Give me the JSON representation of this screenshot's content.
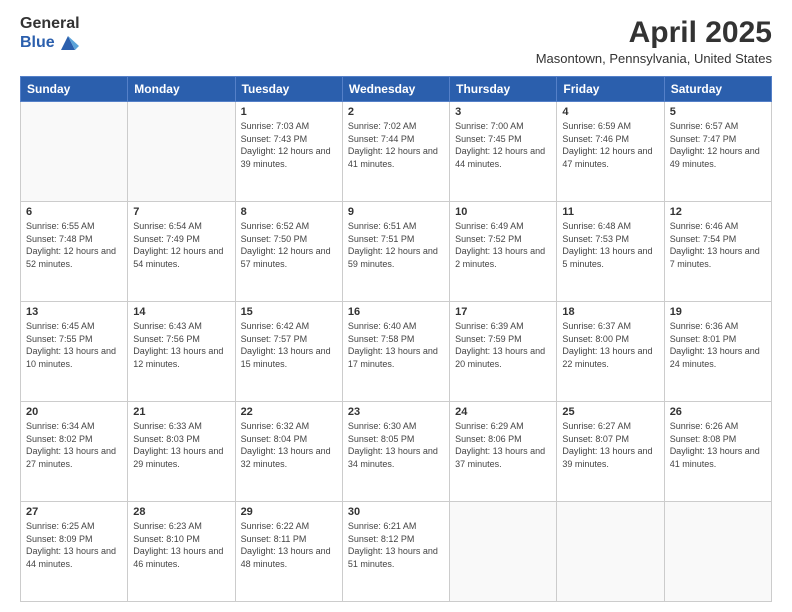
{
  "header": {
    "logo_general": "General",
    "logo_blue": "Blue",
    "title": "April 2025",
    "subtitle": "Masontown, Pennsylvania, United States"
  },
  "calendar": {
    "days_of_week": [
      "Sunday",
      "Monday",
      "Tuesday",
      "Wednesday",
      "Thursday",
      "Friday",
      "Saturday"
    ],
    "weeks": [
      [
        {
          "day": "",
          "info": ""
        },
        {
          "day": "",
          "info": ""
        },
        {
          "day": "1",
          "info": "Sunrise: 7:03 AM\nSunset: 7:43 PM\nDaylight: 12 hours and 39 minutes."
        },
        {
          "day": "2",
          "info": "Sunrise: 7:02 AM\nSunset: 7:44 PM\nDaylight: 12 hours and 41 minutes."
        },
        {
          "day": "3",
          "info": "Sunrise: 7:00 AM\nSunset: 7:45 PM\nDaylight: 12 hours and 44 minutes."
        },
        {
          "day": "4",
          "info": "Sunrise: 6:59 AM\nSunset: 7:46 PM\nDaylight: 12 hours and 47 minutes."
        },
        {
          "day": "5",
          "info": "Sunrise: 6:57 AM\nSunset: 7:47 PM\nDaylight: 12 hours and 49 minutes."
        }
      ],
      [
        {
          "day": "6",
          "info": "Sunrise: 6:55 AM\nSunset: 7:48 PM\nDaylight: 12 hours and 52 minutes."
        },
        {
          "day": "7",
          "info": "Sunrise: 6:54 AM\nSunset: 7:49 PM\nDaylight: 12 hours and 54 minutes."
        },
        {
          "day": "8",
          "info": "Sunrise: 6:52 AM\nSunset: 7:50 PM\nDaylight: 12 hours and 57 minutes."
        },
        {
          "day": "9",
          "info": "Sunrise: 6:51 AM\nSunset: 7:51 PM\nDaylight: 12 hours and 59 minutes."
        },
        {
          "day": "10",
          "info": "Sunrise: 6:49 AM\nSunset: 7:52 PM\nDaylight: 13 hours and 2 minutes."
        },
        {
          "day": "11",
          "info": "Sunrise: 6:48 AM\nSunset: 7:53 PM\nDaylight: 13 hours and 5 minutes."
        },
        {
          "day": "12",
          "info": "Sunrise: 6:46 AM\nSunset: 7:54 PM\nDaylight: 13 hours and 7 minutes."
        }
      ],
      [
        {
          "day": "13",
          "info": "Sunrise: 6:45 AM\nSunset: 7:55 PM\nDaylight: 13 hours and 10 minutes."
        },
        {
          "day": "14",
          "info": "Sunrise: 6:43 AM\nSunset: 7:56 PM\nDaylight: 13 hours and 12 minutes."
        },
        {
          "day": "15",
          "info": "Sunrise: 6:42 AM\nSunset: 7:57 PM\nDaylight: 13 hours and 15 minutes."
        },
        {
          "day": "16",
          "info": "Sunrise: 6:40 AM\nSunset: 7:58 PM\nDaylight: 13 hours and 17 minutes."
        },
        {
          "day": "17",
          "info": "Sunrise: 6:39 AM\nSunset: 7:59 PM\nDaylight: 13 hours and 20 minutes."
        },
        {
          "day": "18",
          "info": "Sunrise: 6:37 AM\nSunset: 8:00 PM\nDaylight: 13 hours and 22 minutes."
        },
        {
          "day": "19",
          "info": "Sunrise: 6:36 AM\nSunset: 8:01 PM\nDaylight: 13 hours and 24 minutes."
        }
      ],
      [
        {
          "day": "20",
          "info": "Sunrise: 6:34 AM\nSunset: 8:02 PM\nDaylight: 13 hours and 27 minutes."
        },
        {
          "day": "21",
          "info": "Sunrise: 6:33 AM\nSunset: 8:03 PM\nDaylight: 13 hours and 29 minutes."
        },
        {
          "day": "22",
          "info": "Sunrise: 6:32 AM\nSunset: 8:04 PM\nDaylight: 13 hours and 32 minutes."
        },
        {
          "day": "23",
          "info": "Sunrise: 6:30 AM\nSunset: 8:05 PM\nDaylight: 13 hours and 34 minutes."
        },
        {
          "day": "24",
          "info": "Sunrise: 6:29 AM\nSunset: 8:06 PM\nDaylight: 13 hours and 37 minutes."
        },
        {
          "day": "25",
          "info": "Sunrise: 6:27 AM\nSunset: 8:07 PM\nDaylight: 13 hours and 39 minutes."
        },
        {
          "day": "26",
          "info": "Sunrise: 6:26 AM\nSunset: 8:08 PM\nDaylight: 13 hours and 41 minutes."
        }
      ],
      [
        {
          "day": "27",
          "info": "Sunrise: 6:25 AM\nSunset: 8:09 PM\nDaylight: 13 hours and 44 minutes."
        },
        {
          "day": "28",
          "info": "Sunrise: 6:23 AM\nSunset: 8:10 PM\nDaylight: 13 hours and 46 minutes."
        },
        {
          "day": "29",
          "info": "Sunrise: 6:22 AM\nSunset: 8:11 PM\nDaylight: 13 hours and 48 minutes."
        },
        {
          "day": "30",
          "info": "Sunrise: 6:21 AM\nSunset: 8:12 PM\nDaylight: 13 hours and 51 minutes."
        },
        {
          "day": "",
          "info": ""
        },
        {
          "day": "",
          "info": ""
        },
        {
          "day": "",
          "info": ""
        }
      ]
    ]
  }
}
